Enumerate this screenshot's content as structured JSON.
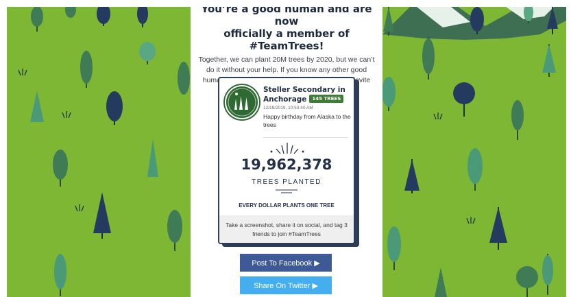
{
  "headline": {
    "line1": "You’re a good human and are now",
    "line2": "officially a member of #TeamTrees!"
  },
  "intro": "Together, we can plant 20M trees by 2020, but we can’t do it without your help. If you know any other good humans, use your favorite social platforms and invite them to join the team too!",
  "donor": {
    "name": "Steller Secondary in Anchorage",
    "trees_badge": "145 TREES",
    "timestamp": "12/19/2019, 10:53:40 AM",
    "message": "Happy birthday from Alaska to the trees"
  },
  "counter": {
    "value": "19,962,378",
    "label": "TREES PLANTED"
  },
  "tagline": "EVERY DOLLAR PLANTS ONE TREE",
  "cta_text": "Take a screenshot, share it on social, and tag 3 friends to join #TeamTrees",
  "buttons": {
    "facebook": "Post To Facebook ▶",
    "twitter": "Share On Twitter ▶"
  },
  "colors": {
    "grass": "#7db734",
    "dark_tree": "#243a5e",
    "green_tree": "#3d6f4a",
    "facebook": "#3d5a96",
    "twitter": "#45aef0",
    "badge": "#3f7c37"
  }
}
